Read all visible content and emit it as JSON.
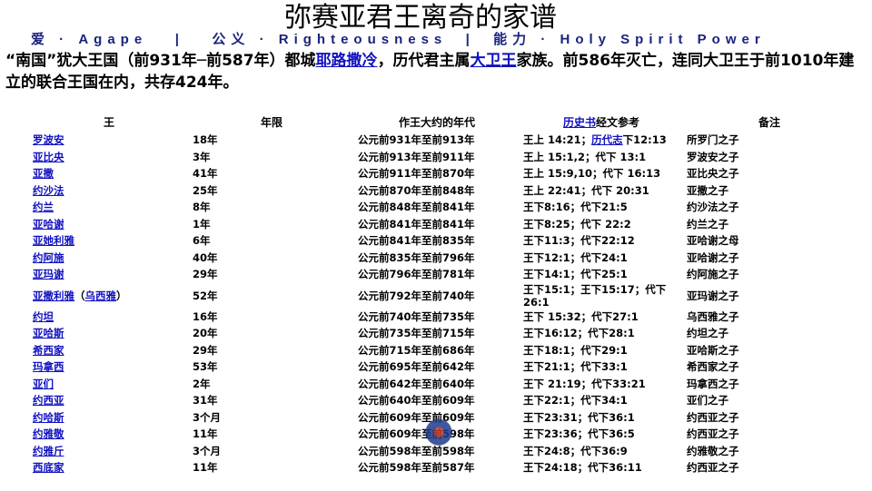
{
  "title": "弥赛亚君王离奇的家谱",
  "motto": {
    "part1": "爱 · Agape",
    "sep1": "|",
    "part2": "公义 · Righteousness",
    "sep2": "|",
    "part3": "能力 · Holy Spirit Power"
  },
  "intro": {
    "t1": "“南国”犹大王国（前931年─前587年）都城",
    "link1": "耶路撒冷",
    "t2": "，历代君主属",
    "link2": "大卫王",
    "t3": "家族。前586年灭亡，连同大卫王于前1010年建立的联合王国在内，共存424年。"
  },
  "table": {
    "headers": {
      "king": "王",
      "years": "年限",
      "date": "作王大约的年代",
      "ref_link": "历史书",
      "ref_text": "经文参考",
      "note": "备注"
    },
    "rows": [
      {
        "king": "罗波安",
        "years": "18年",
        "date": "公元前931年至前913年",
        "ref": "王上 14:21；",
        "ref_link": "历代志",
        "ref2": "下12:13",
        "note": "所罗门之子"
      },
      {
        "king": "亚比央",
        "years": "3年",
        "date": "公元前913年至前911年",
        "ref": "王上 15:1,2；代下 13:1",
        "note": "罗波安之子"
      },
      {
        "king": "亚撒",
        "years": "41年",
        "date": "公元前911年至前870年",
        "ref": "王上 15:9,10；代下 16:13",
        "note": "亚比央之子"
      },
      {
        "king": "约沙法",
        "years": "25年",
        "date": "公元前870年至前848年",
        "ref": "王上 22:41；代下 20:31",
        "note": "亚撒之子"
      },
      {
        "king": "约兰",
        "years": "8年",
        "date": "公元前848年至前841年",
        "ref": "王下8:16；代下21:5",
        "note": "约沙法之子"
      },
      {
        "king": "亚哈谢",
        "years": "1年",
        "date": "公元前841年至前841年",
        "ref": "王下8:25；代下 22:2",
        "note": "约兰之子"
      },
      {
        "king": "亚她利雅",
        "years": "6年",
        "date": "公元前841年至前835年",
        "ref": "王下11:3；代下22:12",
        "note": "亚哈谢之母"
      },
      {
        "king": "约阿施",
        "years": "40年",
        "date": "公元前835年至前796年",
        "ref": "王下12:1；代下24:1",
        "note": "亚哈谢之子"
      },
      {
        "king": "亚玛谢",
        "years": "29年",
        "date": "公元前796年至前781年",
        "ref": "王下14:1；代下25:1",
        "note": "约阿施之子"
      },
      {
        "king": "亚撒利雅",
        "king_alt": "乌西雅",
        "years": "52年",
        "date": "公元前792年至前740年",
        "ref": "王下15:1；王下15:17；代下26:1",
        "note": "亚玛谢之子"
      },
      {
        "king": "约坦",
        "years": "16年",
        "date": "公元前740年至前735年",
        "ref": "王下 15:32；代下27:1",
        "note": "乌西雅之子"
      },
      {
        "king": "亚哈斯",
        "years": "20年",
        "date": "公元前735年至前715年",
        "ref": "王下16:12；代下28:1",
        "note": "约坦之子"
      },
      {
        "king": "希西家",
        "years": "29年",
        "date": "公元前715年至前686年",
        "ref": "王下18:1；代下29:1",
        "note": "亚哈斯之子"
      },
      {
        "king": "玛拿西",
        "years": "53年",
        "date": "公元前695年至前642年",
        "ref": "王下21:1；代下33:1",
        "note": "希西家之子"
      },
      {
        "king": "亚们",
        "years": "2年",
        "date": "公元前642年至前640年",
        "ref": "王下 21:19；代下33:21",
        "note": "玛拿西之子"
      },
      {
        "king": "约西亚",
        "years": "31年",
        "date": "公元前640年至前609年",
        "ref": "王下22:1；代下34:1",
        "note": "亚们之子"
      },
      {
        "king": "约哈斯",
        "years": "3个月",
        "date": "公元前609年至前609年",
        "ref": "王下23:31；代下36:1",
        "note": "约西亚之子"
      },
      {
        "king": "约雅敬",
        "years": "11年",
        "date": "公元前609年至前598年",
        "ref": "王下23:36；代下36:5",
        "note": "约西亚之子"
      },
      {
        "king": "约雅斤",
        "years": "3个月",
        "date": "公元前598年至前598年",
        "ref": "王下24:8；代下36:9",
        "note": "约雅敬之子"
      },
      {
        "king": "西底家",
        "years": "11年",
        "date": "公元前598年至前587年",
        "ref": "王下24:18；代下36:11",
        "note": "约西亚之子"
      }
    ]
  }
}
